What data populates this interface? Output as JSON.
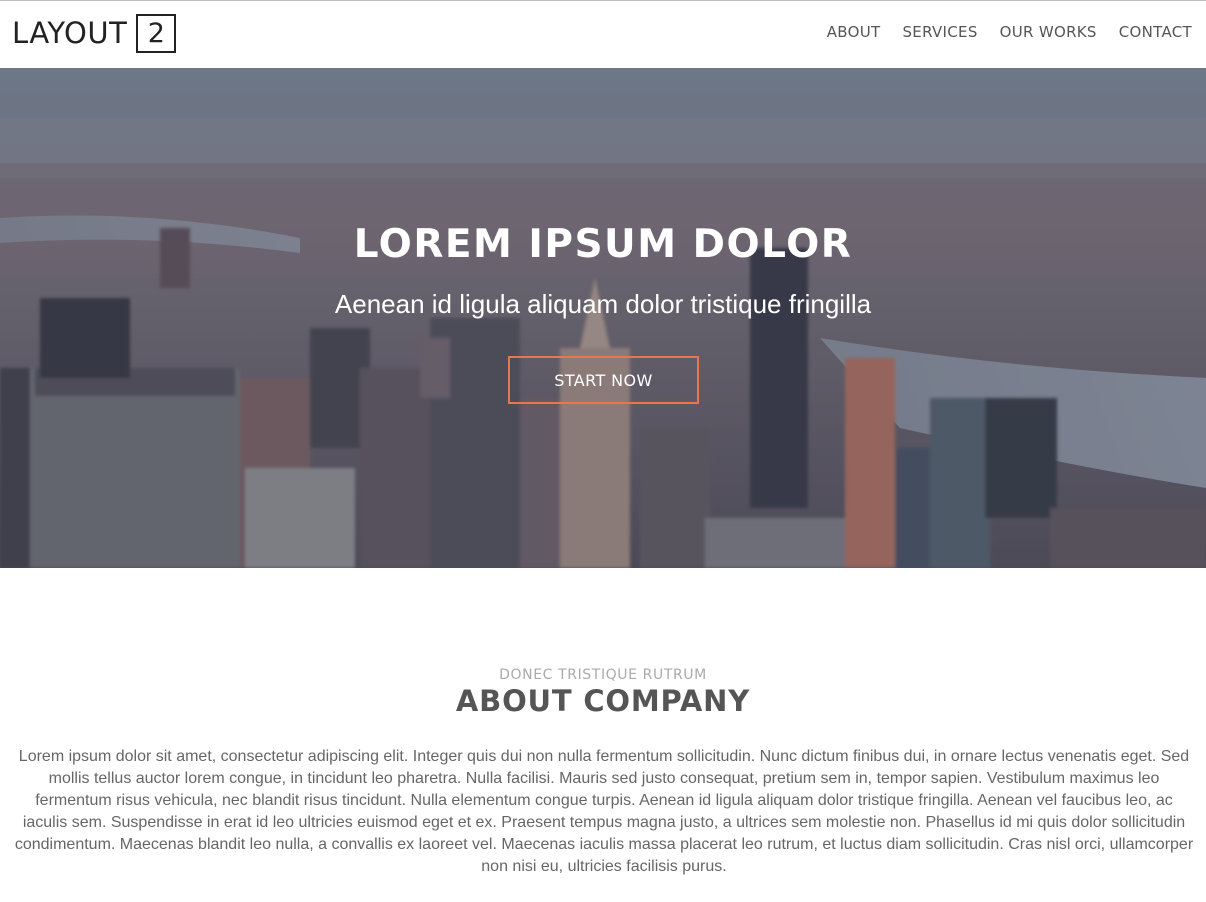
{
  "header": {
    "logo_text": "LAYOUT",
    "logo_number": "2",
    "nav": [
      "ABOUT",
      "SERVICES",
      "OUR WORKS",
      "CONTACT"
    ]
  },
  "hero": {
    "title": "LOREM IPSUM DOLOR",
    "subtitle": "Aenean id ligula aliquam dolor tristique fringilla",
    "button_label": "START NOW",
    "button_border_color": "#e8774b"
  },
  "about": {
    "kicker": "DONEC TRISTIQUE RUTRUM",
    "title": "ABOUT COMPANY",
    "body": "Lorem ipsum dolor sit amet, consectetur adipiscing elit. Integer quis dui non nulla fermentum sollicitudin. Nunc dictum finibus dui, in ornare lectus venenatis eget. Sed mollis tellus auctor lorem congue, in tincidunt leo pharetra. Nulla facilisi. Mauris sed justo consequat, pretium sem in, tempor sapien. Vestibulum maximus leo fermentum risus vehicula, nec blandit risus tincidunt. Nulla elementum congue turpis. Aenean id ligula aliquam dolor tristique fringilla. Aenean vel faucibus leo, ac iaculis sem. Suspendisse in erat id leo ultricies euismod eget et ex. Praesent tempus magna justo, a ultrices sem molestie non. Phasellus id mi quis dolor sollicitudin condimentum. Maecenas blandit leo nulla, a convallis ex laoreet vel. Maecenas iaculis massa placerat leo rutrum, et luctus diam sollicitudin. Cras nisl orci, ullamcorper non nisi eu, ultricies facilisis purus."
  }
}
